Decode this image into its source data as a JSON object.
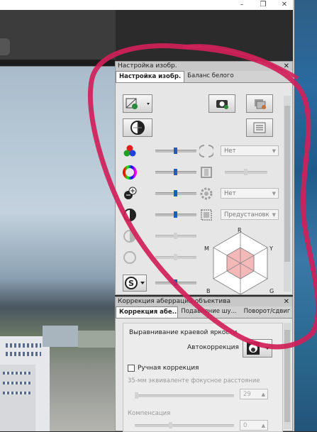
{
  "window": {
    "controls": [
      "–",
      "❐",
      "✕"
    ]
  },
  "panel_adjust": {
    "title": "Настройка изобр.",
    "tabs": [
      "Настройка изобр.",
      "Баланс белого"
    ],
    "dropdowns": [
      "Нет",
      "Нет",
      "Предустановк"
    ],
    "hex_labels": {
      "r": "R",
      "m": "M",
      "y": "Y",
      "b1": "B",
      "b2": "R",
      "g": "G"
    },
    "sliders": {
      "color_saturation": 0.5,
      "hue": 0.5,
      "plus_minus": 0.5,
      "contrast": 0.5,
      "disabled_a": 0.5,
      "disabled_b": 0.5,
      "s_row": 0.5,
      "right_a": 0.5
    }
  },
  "panel_lens": {
    "title": "Коррекция аберраций объектива",
    "tabs": [
      "Коррекция абе...",
      "Подавление шу...",
      "Поворот/сдвиг"
    ],
    "section_title": "Выравнивание краевой яркости",
    "auto_label": "Автокоррекция",
    "manual_label": "Ручная коррекция",
    "manual_checked": false,
    "focal_label": "35-мм эквиваленте фокусное расстояние",
    "focal_value": "29",
    "compensation_label": "Компенсация",
    "compensation_value": "0"
  },
  "icons": {
    "close": "✕"
  },
  "colors": {
    "annotation": "#d0215a",
    "slider_thumb": "#1a5fc0"
  }
}
